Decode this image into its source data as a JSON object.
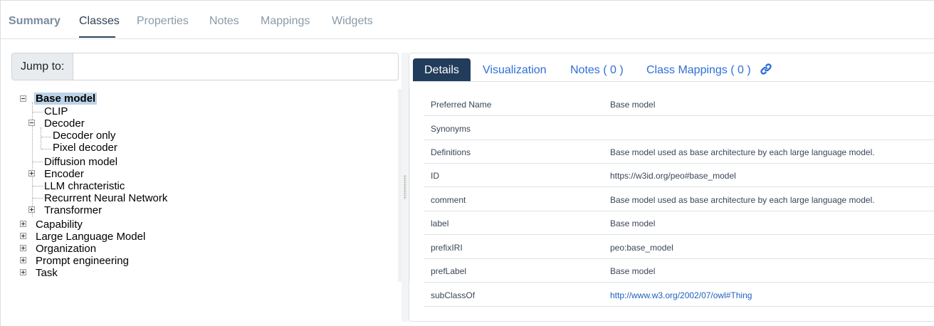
{
  "top_tabs": [
    "Summary",
    "Classes",
    "Properties",
    "Notes",
    "Mappings",
    "Widgets"
  ],
  "jump": {
    "label": "Jump to:",
    "value": ""
  },
  "tree": {
    "base_model": "Base model",
    "clip": "CLIP",
    "decoder": "Decoder",
    "decoder_only": "Decoder only",
    "pixel_decoder": "Pixel decoder",
    "diffusion_model": "Diffusion model",
    "encoder": "Encoder",
    "llm_chracteristic": "LLM chracteristic",
    "rnn": "Recurrent Neural Network",
    "transformer": "Transformer",
    "capability": "Capability",
    "llm": "Large Language Model",
    "organization": "Organization",
    "prompt_engineering": "Prompt engineering",
    "task": "Task"
  },
  "detail_tabs": {
    "details": "Details",
    "visualization": "Visualization",
    "notes": "Notes ( 0 )",
    "class_mappings": "Class Mappings ( 0 )"
  },
  "icons": {
    "permalink": "link-icon"
  },
  "colors": {
    "active_tab": "#223c5c",
    "link": "#2e6fd6",
    "selected_node": "#bcd3e8"
  },
  "details": [
    {
      "key": "Preferred Name",
      "value": "Base model"
    },
    {
      "key": "Synonyms",
      "value": ""
    },
    {
      "key": "Definitions",
      "value": "Base model used as base architecture by each large language model."
    },
    {
      "key": "ID",
      "value": "https://w3id.org/peo#base_model"
    },
    {
      "key": "comment",
      "value": "Base model used as base architecture by each large language model."
    },
    {
      "key": "label",
      "value": "Base model"
    },
    {
      "key": "prefixIRI",
      "value": "peo:base_model"
    },
    {
      "key": "prefLabel",
      "value": "Base model"
    },
    {
      "key": "subClassOf",
      "value": "http://www.w3.org/2002/07/owl#Thing"
    }
  ]
}
